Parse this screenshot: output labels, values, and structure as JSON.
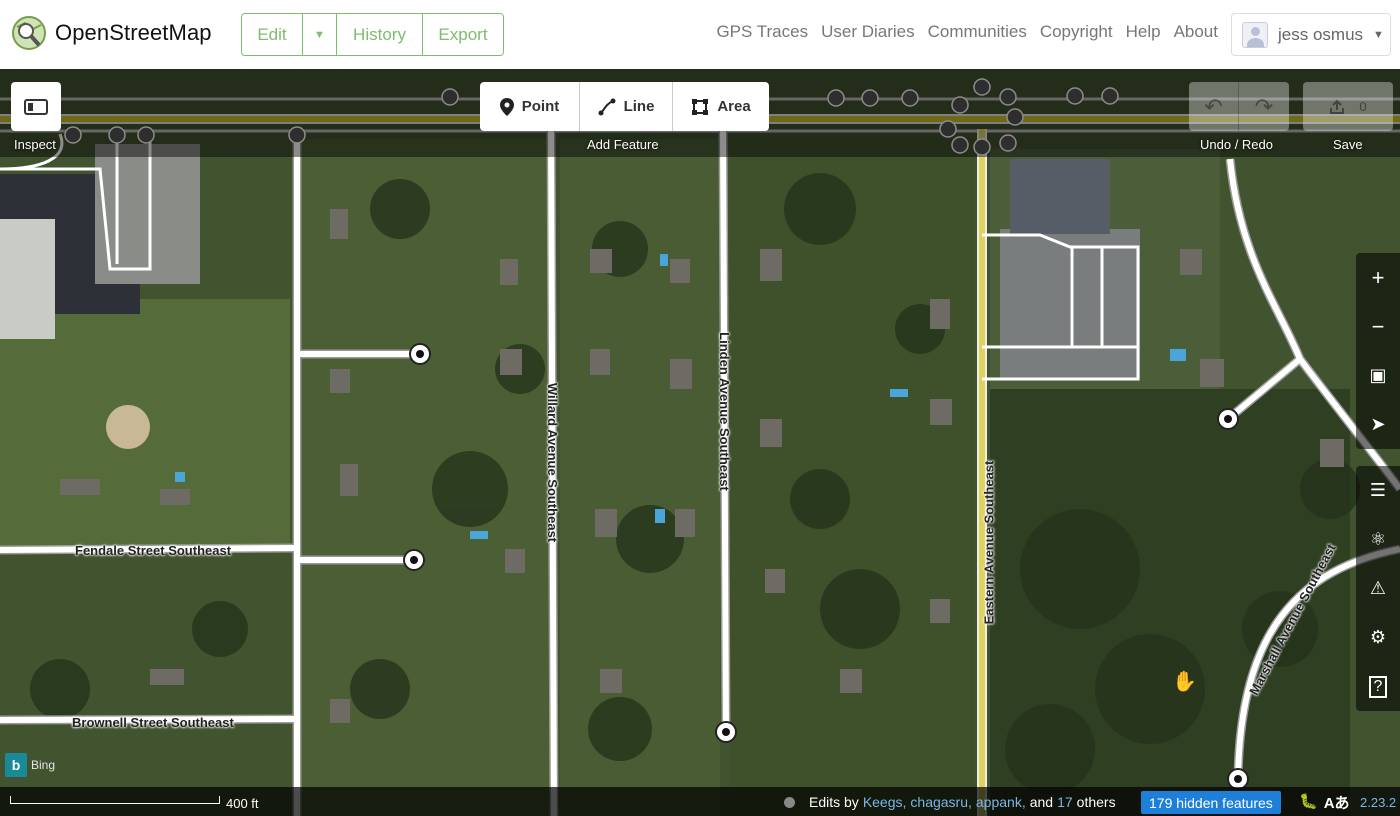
{
  "header": {
    "brand": "OpenStreetMap",
    "edit_label": "Edit",
    "history_label": "History",
    "export_label": "Export",
    "nav": [
      "GPS Traces",
      "User Diaries",
      "Communities",
      "Copyright",
      "Help",
      "About"
    ],
    "user_name": "jess osmus"
  },
  "toolbar": {
    "inspect_label": "Inspect",
    "add_feature_label": "Add Feature",
    "point_label": "Point",
    "line_label": "Line",
    "area_label": "Area",
    "undo_redo_label": "Undo / Redo",
    "save_label": "Save",
    "save_count": "0"
  },
  "map": {
    "streets": {
      "willard": "Willard Avenue Southeast",
      "linden": "Linden Avenue Southeast",
      "eastern": "Eastern Avenue Southeast",
      "fendale": "Fendale Street Southeast",
      "brownell": "Brownell Street Southeast",
      "marshall": "Marshall Avenue Southeast"
    },
    "imagery_label": "Bing"
  },
  "footer": {
    "scale_label": "400 ft",
    "edits_by": "Edits by",
    "editors": [
      "Keegs,",
      "chagasru,",
      "appank,"
    ],
    "and_label": "and",
    "others_count": "17",
    "others_label": "others",
    "hidden_features": "179 hidden features",
    "language_label": "Aあ",
    "version": "2.23.2"
  },
  "colors": {
    "osm_green": "#7ebc6f",
    "link_blue": "#7ab6e8",
    "hidden_badge": "#1d7fd8",
    "primary_road": "#c6c02a"
  }
}
